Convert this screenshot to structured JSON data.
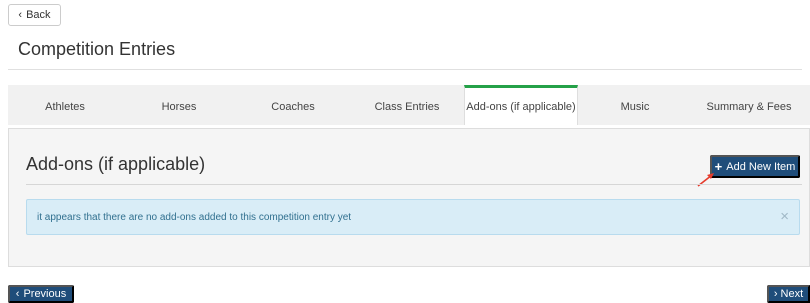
{
  "nav": {
    "back_label": "Back"
  },
  "page": {
    "title": "Competition Entries"
  },
  "tabs": [
    {
      "label": "Athletes"
    },
    {
      "label": "Horses"
    },
    {
      "label": "Coaches"
    },
    {
      "label": "Class Entries"
    },
    {
      "label": "Add-ons (if applicable)",
      "active": true
    },
    {
      "label": "Music"
    },
    {
      "label": "Summary & Fees"
    }
  ],
  "section": {
    "title": "Add-ons (if applicable)",
    "add_button_label": "Add New Item"
  },
  "alert": {
    "message": "it appears that there are no add-ons added to this competition entry yet",
    "close_glyph": "×"
  },
  "footer": {
    "previous_label": "Previous",
    "next_label": "Next"
  },
  "colors": {
    "primary_button": "#1f4d7a",
    "active_tab_accent": "#24a148",
    "alert_bg": "#d9edf7",
    "alert_text": "#31708f",
    "annotation_arrow": "#e53b2c"
  }
}
